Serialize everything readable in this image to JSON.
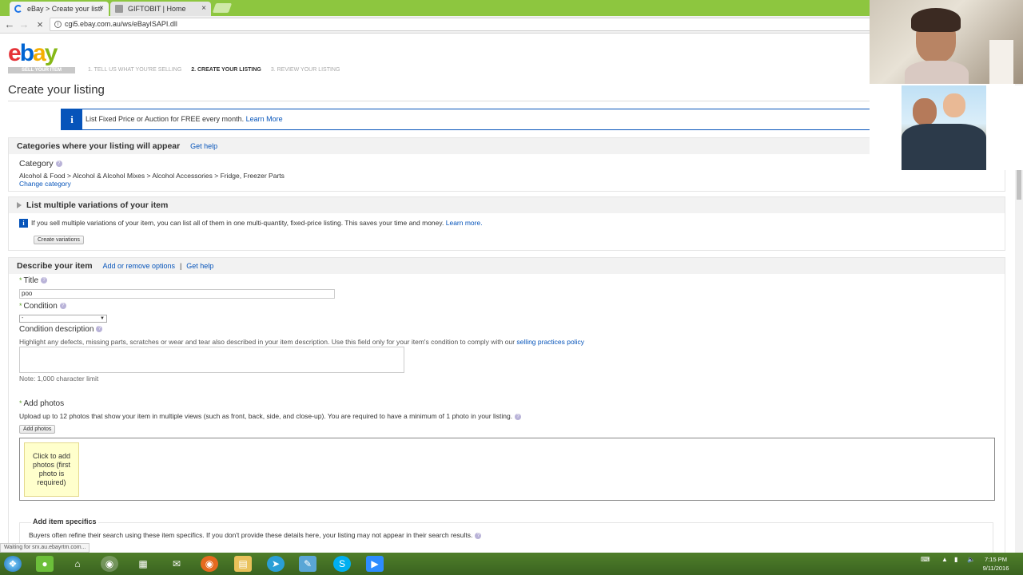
{
  "browser": {
    "tabs": [
      {
        "label": "eBay > Create your listi",
        "close": "×"
      },
      {
        "label": "GIFTOBIT | Home",
        "close": "×"
      }
    ],
    "url": "cgi5.ebay.com.au/ws/eBayISAPI.dll",
    "status_text": "Waiting for srx.au.ebayrtm.com..."
  },
  "header": {
    "logo_letters": [
      "e",
      "b",
      "a",
      "y"
    ],
    "logo_sub": "SELL YOUR ITEM",
    "steps": [
      "1. TELL US WHAT YOU'RE SELLING",
      "2. CREATE YOUR LISTING",
      "3. REVIEW YOUR LISTING"
    ],
    "page_title": "Create your listing"
  },
  "banner": {
    "icon": "i",
    "text": "List Fixed Price or Auction for FREE every month.",
    "link": "Learn More"
  },
  "categories": {
    "heading": "Categories where your listing will appear",
    "help_link": "Get help",
    "label": "Category",
    "path": "Alcohol & Food > Alcohol & Alcohol Mixes > Alcohol Accessories > Fridge, Freezer Parts",
    "change_link": "Change category"
  },
  "variations": {
    "heading": "List multiple variations of your item",
    "info": "If you sell multiple variations of your item, you can list all of them in one multi-quantity, fixed-price listing. This saves your time and money.",
    "info_link": "Learn more.",
    "button": "Create variations"
  },
  "describe": {
    "heading": "Describe your item",
    "add_remove_link": "Add or remove options",
    "separator": "|",
    "help_link": "Get help",
    "required_mark": "*",
    "help_icon": "?",
    "title_label": "Title",
    "title_value": "poo",
    "condition_label": "Condition",
    "condition_value": "-",
    "condition_desc_label": "Condition description",
    "condition_desc_help": "Highlight any defects, missing parts, scratches or wear and tear also described in your item description. Use this field only for your item's condition to comply with our",
    "condition_desc_link": "selling practices policy",
    "condition_desc_note": "Note: 1,000 character limit"
  },
  "photos": {
    "label": "Add photos",
    "help": "Upload up to 12 photos that show your item in multiple views (such as front, back, side, and close-up).  You are required to have a minimum of 1 photo in your listing.",
    "button": "Add photos",
    "slot_text": "Click to add photos (first photo is required)"
  },
  "specifics": {
    "heading": "Add item specifics",
    "help": "Buyers often refine their search using these item specifics. If you don't provide these details here, your listing may not appear in their search results."
  },
  "taskbar": {
    "icons": [
      "start-orb-icon",
      "app-green-icon",
      "home-icon",
      "chrome-icon",
      "calculator-icon",
      "mail-icon",
      "firefox-icon",
      "folder-icon",
      "telegram-icon",
      "notes-icon",
      "skype-icon",
      "zoom-icon"
    ],
    "time": "7:15 PM",
    "date": "9/11/2016"
  },
  "colors": {
    "tabbar": "#8dc63f",
    "ebay_blue": "#0654ba",
    "section_header": "#f2f2f2",
    "photo_slot": "#ffffcc",
    "taskbar": "#3a6320"
  }
}
